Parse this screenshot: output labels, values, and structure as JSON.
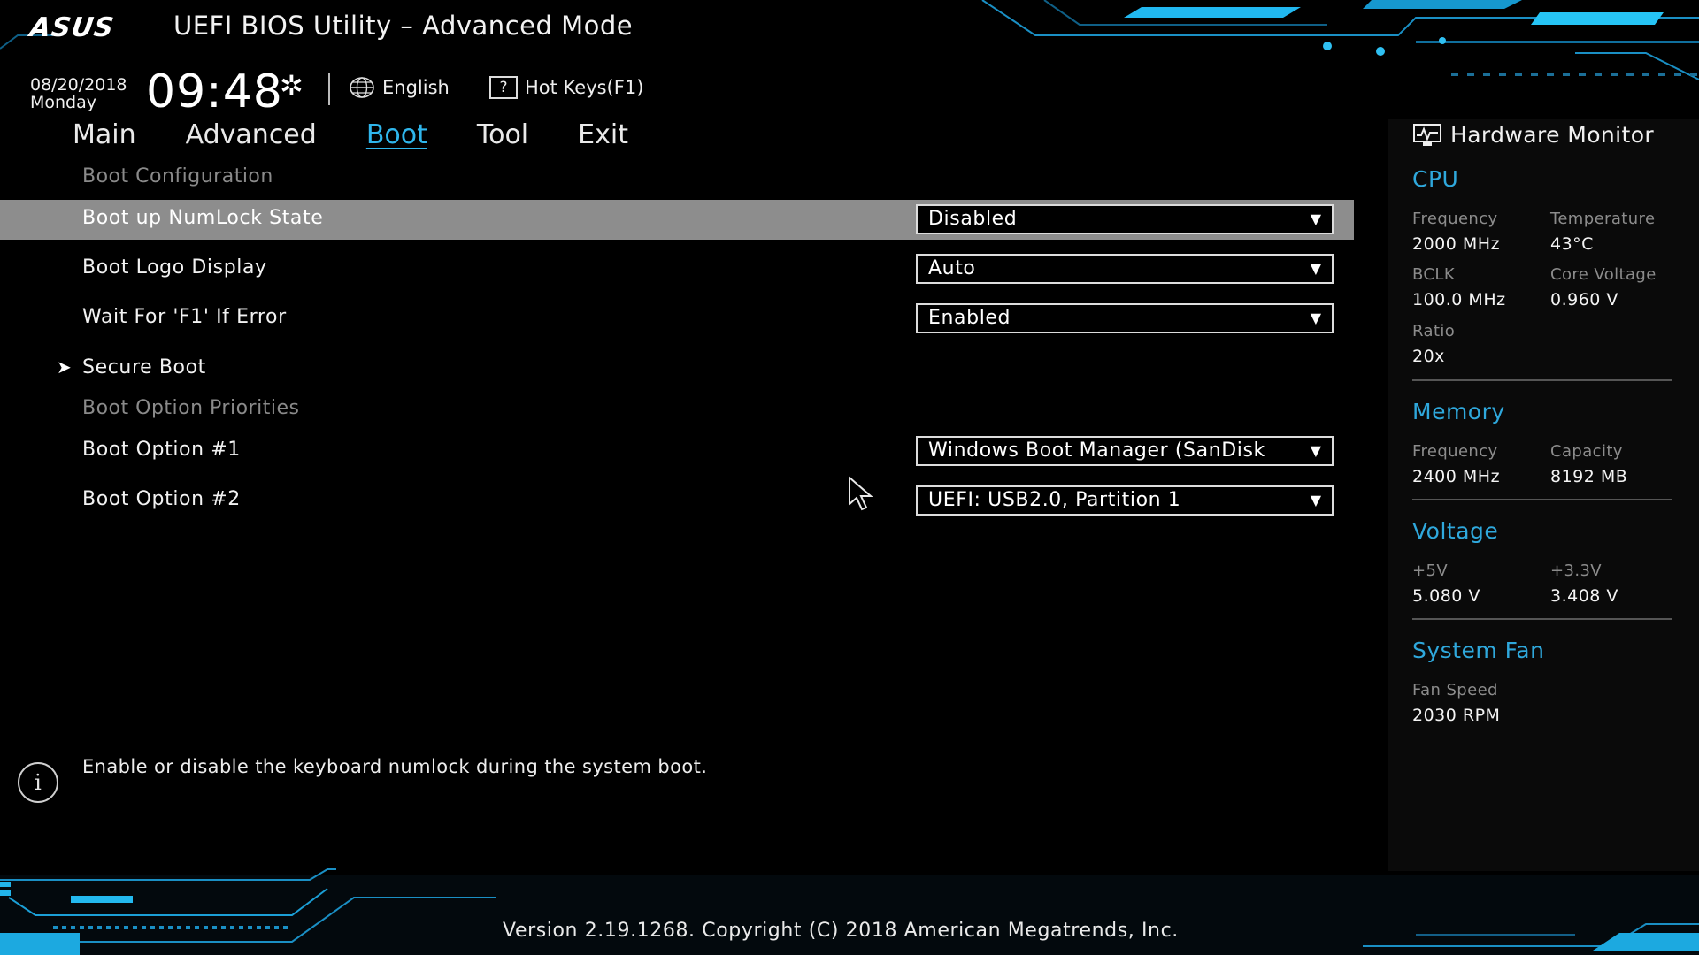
{
  "header": {
    "brand": "ASUS",
    "title": "UEFI BIOS Utility – Advanced Mode",
    "date": "08/20/2018",
    "day": "Monday",
    "time": "09:48",
    "language": "English",
    "hotkeys": "Hot Keys(F1)"
  },
  "tabs": [
    "Main",
    "Advanced",
    "Boot",
    "Tool",
    "Exit"
  ],
  "active_tab": "Boot",
  "sections": {
    "boot_configuration": "Boot Configuration",
    "boot_option_priorities": "Boot Option Priorities"
  },
  "settings": {
    "numlock": {
      "label": "Boot up NumLock State",
      "value": "Disabled"
    },
    "logo": {
      "label": "Boot Logo Display",
      "value": "Auto"
    },
    "f1_error": {
      "label": "Wait For 'F1' If Error",
      "value": "Enabled"
    },
    "secure_boot": {
      "label": "Secure Boot"
    },
    "boot1": {
      "label": "Boot Option #1",
      "value": "Windows Boot Manager (SanDisk"
    },
    "boot2": {
      "label": "Boot Option #2",
      "value": "UEFI: USB2.0, Partition 1"
    }
  },
  "help_text": "Enable or disable the keyboard numlock during the system boot.",
  "hardware_monitor": {
    "title": "Hardware Monitor",
    "cpu": {
      "title": "CPU",
      "frequency_label": "Frequency",
      "frequency": "2000 MHz",
      "temperature_label": "Temperature",
      "temperature": "43°C",
      "bclk_label": "BCLK",
      "bclk": "100.0 MHz",
      "core_voltage_label": "Core Voltage",
      "core_voltage": "0.960 V",
      "ratio_label": "Ratio",
      "ratio": "20x"
    },
    "memory": {
      "title": "Memory",
      "frequency_label": "Frequency",
      "frequency": "2400 MHz",
      "capacity_label": "Capacity",
      "capacity": "8192 MB"
    },
    "voltage": {
      "title": "Voltage",
      "v5_label": "+5V",
      "v5": "5.080 V",
      "v33_label": "+3.3V",
      "v33": "3.408 V"
    },
    "fan": {
      "title": "System Fan",
      "speed_label": "Fan Speed",
      "speed": "2030 RPM"
    }
  },
  "footer": "Version 2.19.1268. Copyright (C) 2018 American Megatrends, Inc.",
  "colors": {
    "accent": "#2fb6ec",
    "highlight_row": "#8d8d8d",
    "background": "#000000"
  },
  "icons": [
    "gear-icon",
    "globe-icon",
    "help-key-icon",
    "monitor-icon",
    "info-icon",
    "dropdown-caret-icon",
    "submenu-arrow-icon",
    "mouse-pointer-icon"
  ]
}
